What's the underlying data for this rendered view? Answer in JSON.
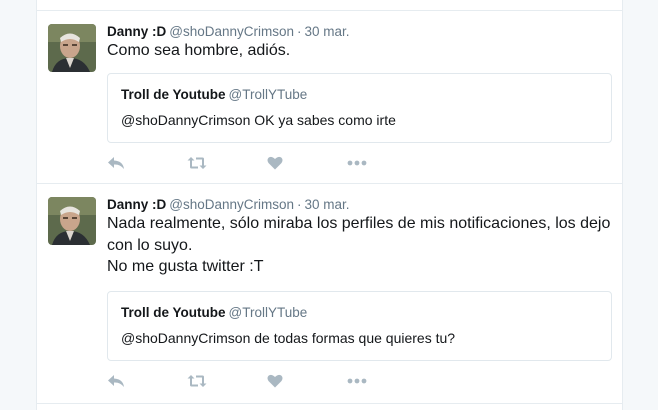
{
  "colors": {
    "name": "#14171a",
    "meta": "#657786",
    "icon": "#aab8c2",
    "border": "#e6ecf0"
  },
  "tweets": [
    {
      "author": {
        "name": "Danny :D",
        "handle": "@shoDannyCrimson"
      },
      "separator": "·",
      "time": "30 mar.",
      "lines": [
        "Como sea hombre, adiós."
      ],
      "quote": {
        "name": "Troll de Youtube",
        "handle": "@TrollYTube",
        "text": "@shoDannyCrimson OK ya sabes como irte"
      },
      "actions": [
        "reply-icon",
        "retweet-icon",
        "like-icon",
        "more-icon"
      ]
    },
    {
      "author": {
        "name": "Danny :D",
        "handle": "@shoDannyCrimson"
      },
      "separator": "·",
      "time": "30 mar.",
      "lines": [
        "Nada realmente, sólo miraba los perfiles de mis notificaciones, los dejo con lo suyo.",
        "No me gusta twitter :T"
      ],
      "quote": {
        "name": "Troll de Youtube",
        "handle": "@TrollYTube",
        "text": "@shoDannyCrimson de todas formas que quieres tu?"
      },
      "actions": [
        "reply-icon",
        "retweet-icon",
        "like-icon",
        "more-icon"
      ]
    }
  ]
}
